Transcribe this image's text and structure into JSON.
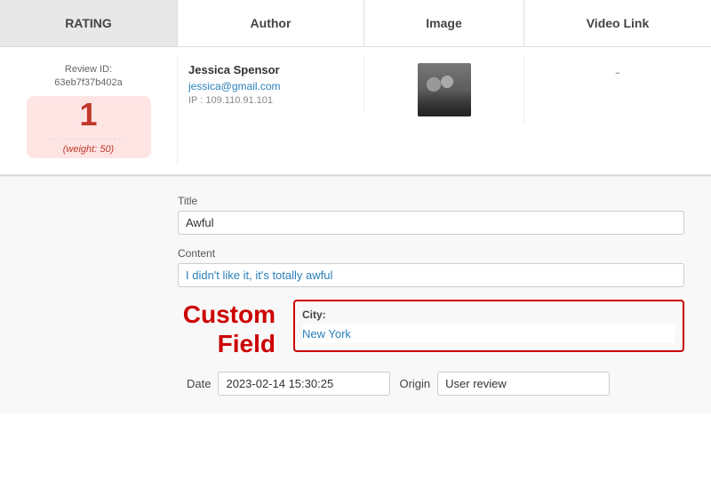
{
  "header": {
    "rating_label": "RATING",
    "author_label": "Author",
    "image_label": "Image",
    "video_link_label": "Video Link"
  },
  "review": {
    "review_id_label": "Review ID:",
    "review_id_value": "63eb7f37b402a",
    "rating_number": "1",
    "rating_dots": "..................",
    "rating_weight": "(weight: 50)",
    "author_name": "Jessica Spensor",
    "author_email": "jessica@gmail.com",
    "author_ip": "IP : 109.110.91.101",
    "video_dash": "-",
    "title_label": "Title",
    "title_value": "Awful",
    "content_label": "Content",
    "content_value": "I didn't like it, it's totally awful",
    "custom_field_label": "Custom\nField",
    "city_label": "City:",
    "city_value": "New York",
    "date_label": "Date",
    "date_value": "2023-02-14 15:30:25",
    "origin_label": "Origin",
    "origin_value": "User review"
  }
}
